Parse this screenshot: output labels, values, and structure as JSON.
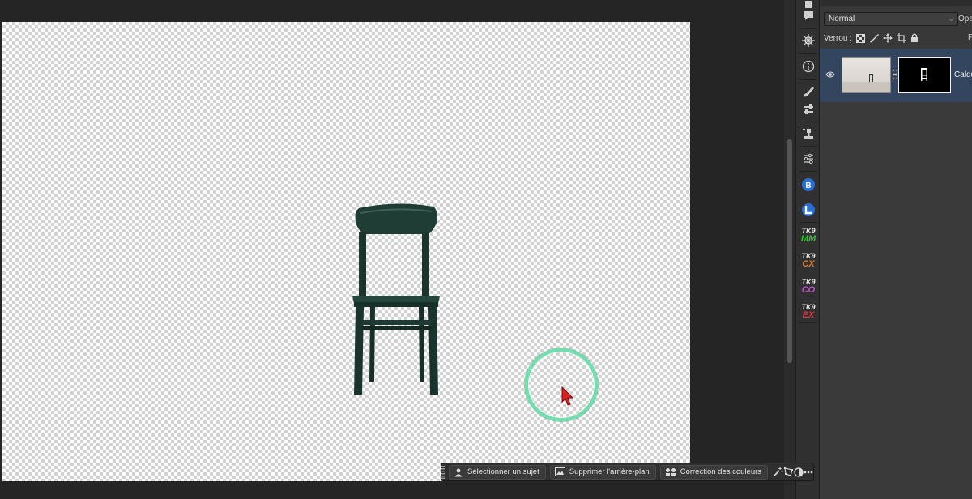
{
  "layers_panel": {
    "blend_mode": "Normal",
    "opacity_label": "Opa",
    "lock_label": "Verrou :",
    "fill_label": "F",
    "layer": {
      "name": "Calqu"
    }
  },
  "tool_rail": {
    "plugins": [
      {
        "top": "TK9",
        "bottom": "MM",
        "color": "#3fbf3f"
      },
      {
        "top": "TK9",
        "bottom": "CX",
        "color": "#e87d2c"
      },
      {
        "top": "TK9",
        "bottom": "CO",
        "color": "#c04bd0"
      },
      {
        "top": "TK9",
        "bottom": "EX",
        "color": "#d83a48"
      }
    ]
  },
  "task_bar": {
    "select_subject": "Sélectionner un sujet",
    "remove_background": "Supprimer l'arrière-plan",
    "color_correction": "Correction des couleurs"
  },
  "colors": {
    "accent_selection": "#33455f",
    "brush_cursor": "#6fe0ad",
    "chair": "#1d3a32"
  }
}
